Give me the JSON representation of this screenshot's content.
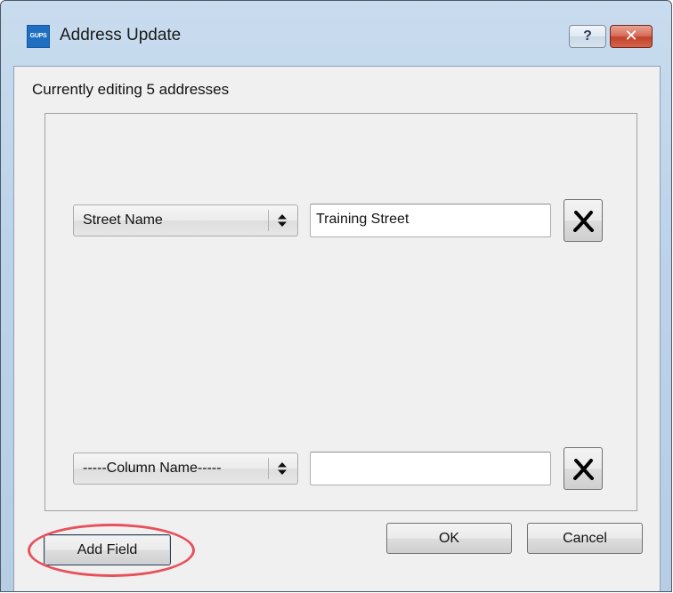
{
  "window": {
    "title": "Address Update",
    "app_icon_text": "GUPS",
    "help_label": "?",
    "close_label": "✕"
  },
  "status": {
    "text": "Currently editing 5 addresses"
  },
  "fields": [
    {
      "column": "Street Name",
      "value": "Training Street",
      "remove_icon": "x-remove-icon"
    },
    {
      "column": "-----Column Name-----",
      "value": "",
      "remove_icon": "x-remove-icon"
    }
  ],
  "buttons": {
    "add_field": "Add Field",
    "ok": "OK",
    "cancel": "Cancel"
  },
  "annotation": {
    "highlight_color": "#e8505b"
  }
}
